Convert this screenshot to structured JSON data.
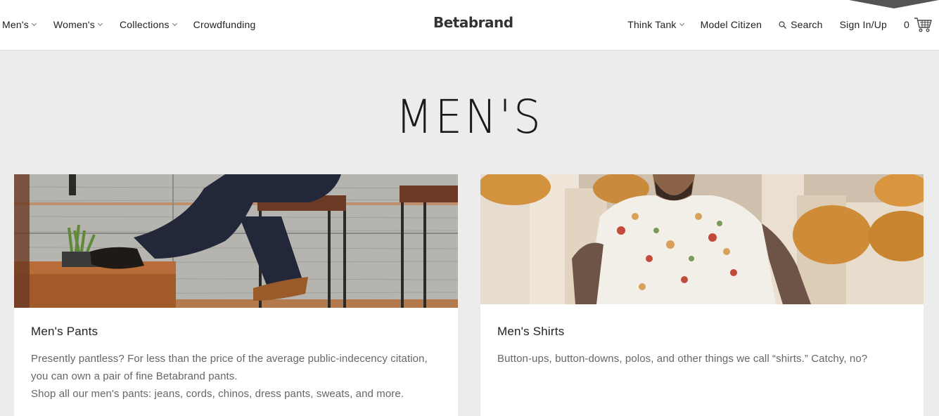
{
  "nav": {
    "left": [
      {
        "label": "Men's",
        "dropdown": true
      },
      {
        "label": "Women's",
        "dropdown": true
      },
      {
        "label": "Collections",
        "dropdown": true
      },
      {
        "label": "Crowdfunding",
        "dropdown": false
      }
    ],
    "logo": "Betabrand",
    "right": {
      "think_tank": "Think Tank",
      "model_citizen": "Model Citizen",
      "search": "Search",
      "sign_in": "Sign In/Up",
      "cart_count": "0"
    }
  },
  "page": {
    "title": "MEN'S"
  },
  "cards": [
    {
      "title": "Men's Pants",
      "desc_lines": [
        "Presently pantless? For less than the price of the average public-indecency citation, you can own a pair of fine Betabrand pants.",
        "Shop all our men's pants: jeans, cords, chinos, dress pants, sweats, and more."
      ]
    },
    {
      "title": "Men's Shirts",
      "desc_lines": [
        "Button-ups, button-downs, polos, and other things we call “shirts.” Catchy, no?"
      ]
    }
  ],
  "icons": {
    "search": "search-icon",
    "cart": "cart-icon",
    "chevron": "chevron-down-icon"
  }
}
